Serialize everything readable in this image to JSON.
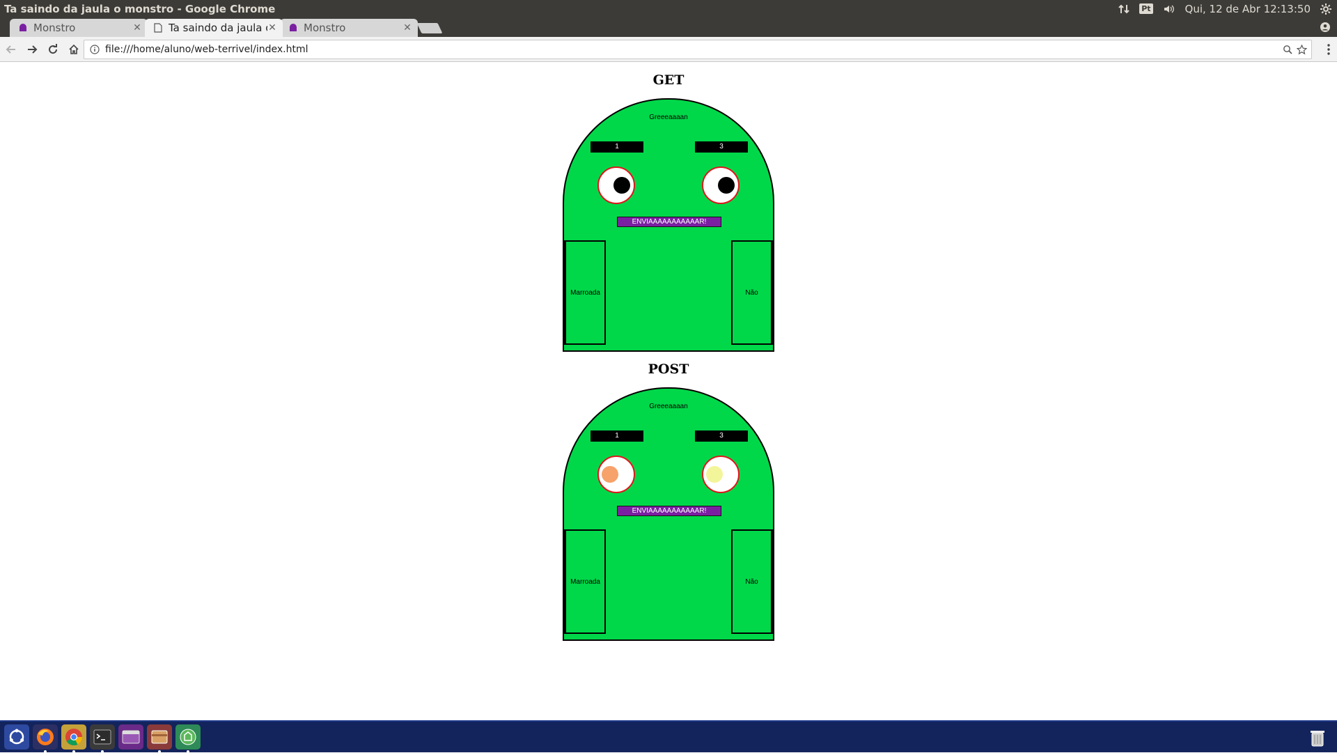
{
  "window": {
    "title": "Ta saindo da jaula o monstro - Google Chrome"
  },
  "tray": {
    "keyboard_label": "Pt",
    "datetime": "Qui, 12 de Abr 12:13:50"
  },
  "tabs": [
    {
      "label": "Monstro",
      "active": false,
      "favicon": "monster-favicon-icon"
    },
    {
      "label": "Ta saindo da jaula o monstro",
      "active": true,
      "favicon": "page-favicon-icon"
    },
    {
      "label": "Monstro",
      "active": false,
      "favicon": "monster-favicon-icon"
    }
  ],
  "address_bar": {
    "url": "file:///home/aluno/web-terrivel/index.html"
  },
  "sections": [
    {
      "heading": "GET",
      "greeting": "Greeeaaaan",
      "left_brow": "1",
      "right_brow": "3",
      "send_label": "ENVIAAAAAAAAAAAR!",
      "left_arm": "Marroada",
      "right_arm": "Não",
      "left_pupil_color": "#000000",
      "right_pupil_color": "#000000"
    },
    {
      "heading": "POST",
      "greeting": "Greeeaaaan",
      "left_brow": "1",
      "right_brow": "3",
      "send_label": "ENVIAAAAAAAAAAAR!",
      "left_arm": "Marroada",
      "right_arm": "Não",
      "left_pupil_color": "#f6a26a",
      "right_pupil_color": "#f3f59a"
    }
  ],
  "colors": {
    "monster_body": "#00d84a",
    "eye_border": "#e0161b",
    "send_button": "#7b1fa2",
    "taskbar": "#13235c"
  },
  "launcher": [
    "ubuntu-dash-icon",
    "firefox-icon",
    "chrome-icon",
    "terminal-icon",
    "app-window-icon",
    "file-manager-icon",
    "software-center-icon",
    "trash-icon"
  ]
}
